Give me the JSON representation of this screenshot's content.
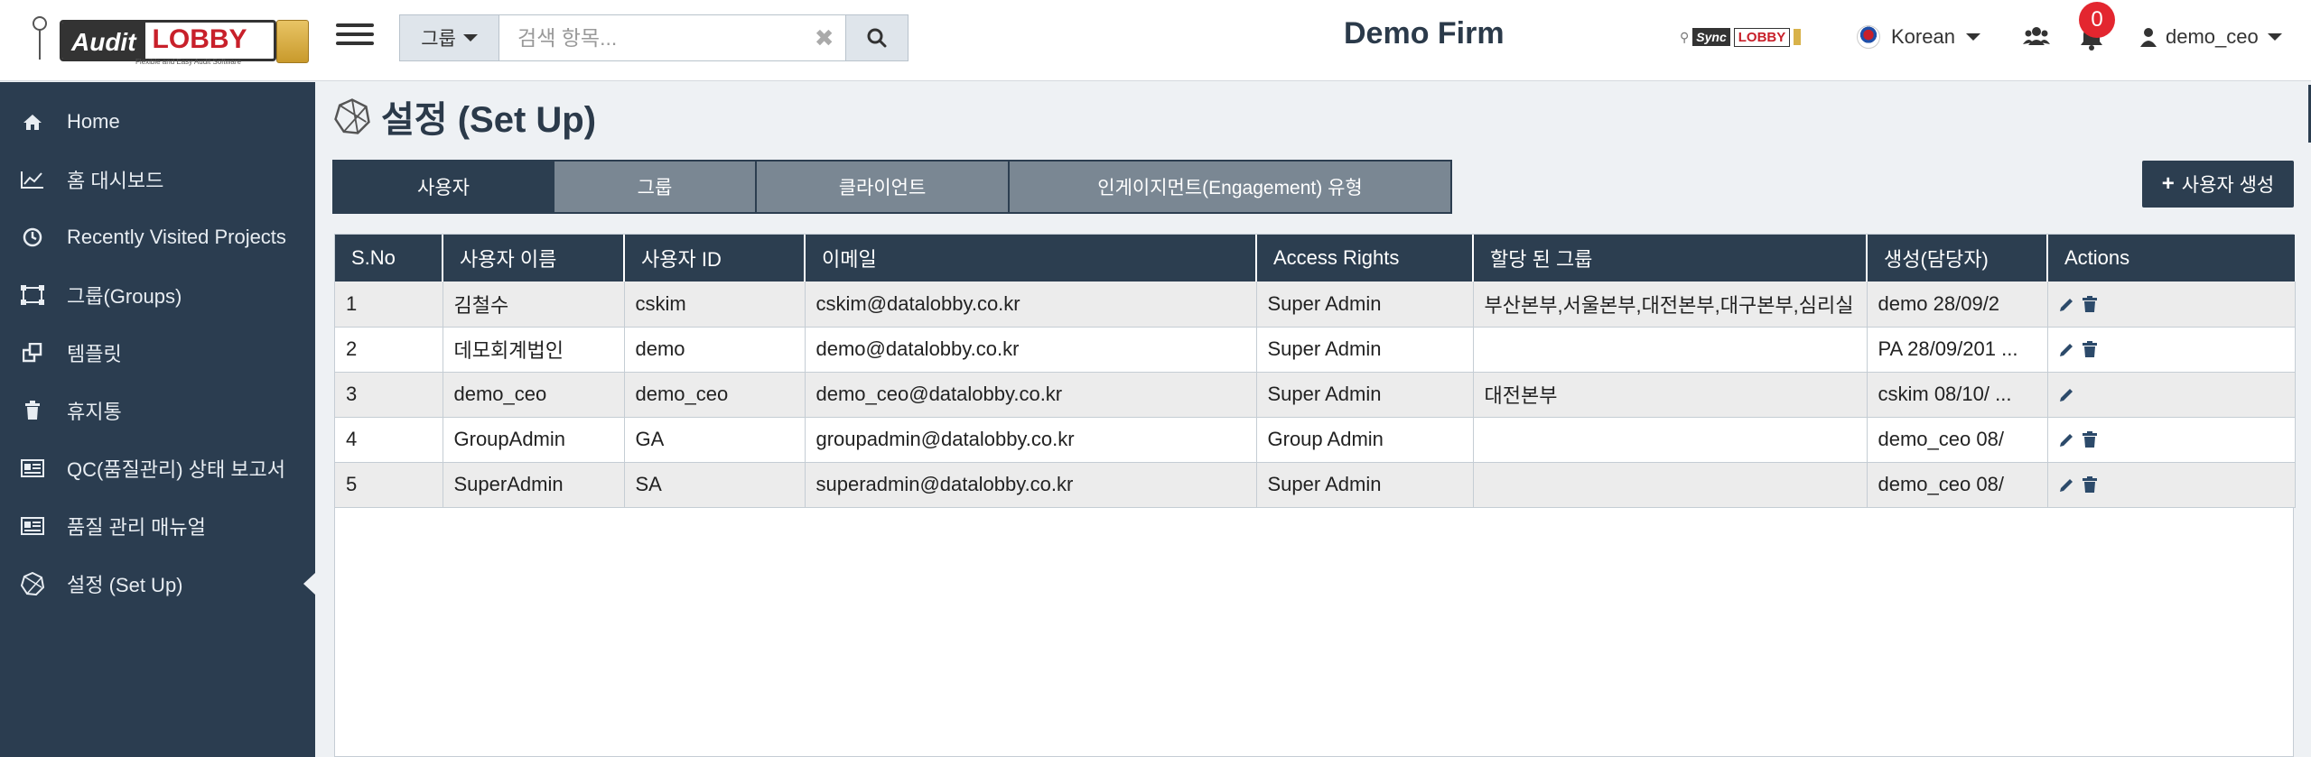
{
  "header": {
    "logo": {
      "audit": "Audit",
      "lobby": "LOBBY",
      "tagline": "Flexible and Easy Audit Software"
    },
    "search": {
      "group_label": "그룹",
      "placeholder": "검색 항목..."
    },
    "firm_name": "Demo Firm",
    "sync": {
      "s1": "Sync",
      "s2": "LOBBY"
    },
    "language": "Korean",
    "notification_count": "0",
    "user": "demo_ceo"
  },
  "sidebar": {
    "items": [
      {
        "label": "Home",
        "icon": "home-icon"
      },
      {
        "label": "홈 대시보드",
        "icon": "line-chart-icon"
      },
      {
        "label": "Recently Visited Projects",
        "icon": "clock-icon"
      },
      {
        "label": "그룹(Groups)",
        "icon": "groups-icon"
      },
      {
        "label": "템플릿",
        "icon": "template-icon"
      },
      {
        "label": "휴지통",
        "icon": "trash-icon"
      },
      {
        "label": "QC(품질관리) 상태 보고서",
        "icon": "report-icon"
      },
      {
        "label": "품질 관리 매뉴얼",
        "icon": "manual-icon"
      },
      {
        "label": "설정 (Set Up)",
        "icon": "setup-icon"
      }
    ]
  },
  "page": {
    "title": "설정 (Set Up)",
    "tabs": [
      "사용자",
      "그룹",
      "클라이언트",
      "인게이지먼트(Engagement) 유형"
    ],
    "create_button": "사용자 생성"
  },
  "table": {
    "headers": [
      "S.No",
      "사용자 이름",
      "사용자 ID",
      "이메일",
      "Access Rights",
      "할당 된 그룹",
      "생성(담당자)",
      "Actions"
    ],
    "rows": [
      {
        "sno": "1",
        "name": "김철수",
        "id": "cskim",
        "email": "cskim@datalobby.co.kr",
        "rights": "Super Admin",
        "groups": "부산본부,서울본부,대전본부,대구본부,심리실",
        "created": "demo 28/09/2"
      },
      {
        "sno": "2",
        "name": "데모회계법인",
        "id": "demo",
        "email": "demo@datalobby.co.kr",
        "rights": "Super Admin",
        "groups": "",
        "created": "PA 28/09/201 ..."
      },
      {
        "sno": "3",
        "name": "demo_ceo",
        "id": "demo_ceo",
        "email": "demo_ceo@datalobby.co.kr",
        "rights": "Super Admin",
        "groups": "대전본부",
        "created": "cskim 08/10/ ..."
      },
      {
        "sno": "4",
        "name": "GroupAdmin",
        "id": "GA",
        "email": "groupadmin@datalobby.co.kr",
        "rights": "Group Admin",
        "groups": "",
        "created": "demo_ceo 08/"
      },
      {
        "sno": "5",
        "name": "SuperAdmin",
        "id": "SA",
        "email": "superadmin@datalobby.co.kr",
        "rights": "Super Admin",
        "groups": "",
        "created": "demo_ceo 08/"
      }
    ]
  },
  "colors": {
    "nav": "#2b3d50",
    "accent": "#2c3e50",
    "badge": "#e3262f",
    "brand_red": "#c8202a"
  }
}
